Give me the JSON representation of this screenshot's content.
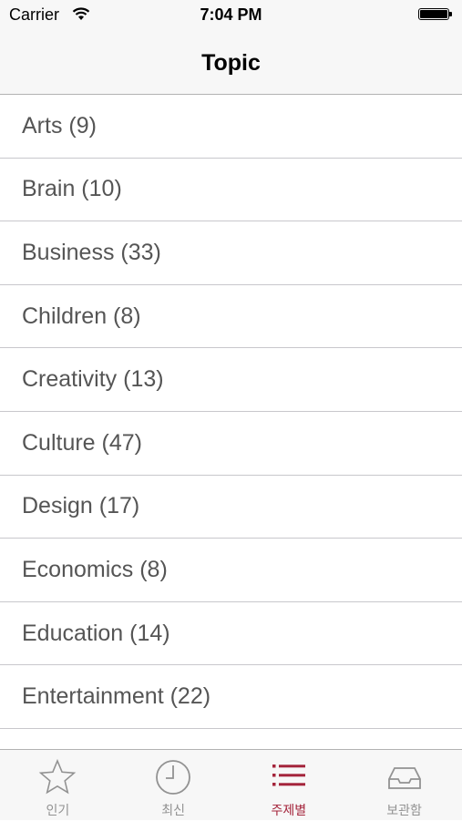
{
  "status_bar": {
    "carrier": "Carrier",
    "time": "7:04 PM"
  },
  "nav": {
    "title": "Topic"
  },
  "topics": [
    {
      "label": "Arts (9)"
    },
    {
      "label": "Brain (10)"
    },
    {
      "label": "Business (33)"
    },
    {
      "label": "Children (8)"
    },
    {
      "label": "Creativity (13)"
    },
    {
      "label": "Culture (47)"
    },
    {
      "label": "Design (17)"
    },
    {
      "label": "Economics (8)"
    },
    {
      "label": "Education (14)"
    },
    {
      "label": "Entertainment (22)"
    },
    {
      "label": ""
    }
  ],
  "tabs": [
    {
      "label": "인기",
      "icon": "star-icon"
    },
    {
      "label": "최신",
      "icon": "clock-icon"
    },
    {
      "label": "주제별",
      "icon": "list-icon",
      "active": true
    },
    {
      "label": "보관함",
      "icon": "inbox-icon"
    }
  ],
  "colors": {
    "accent": "#a4243b",
    "inactive": "#929292",
    "row_text": "#555555"
  }
}
